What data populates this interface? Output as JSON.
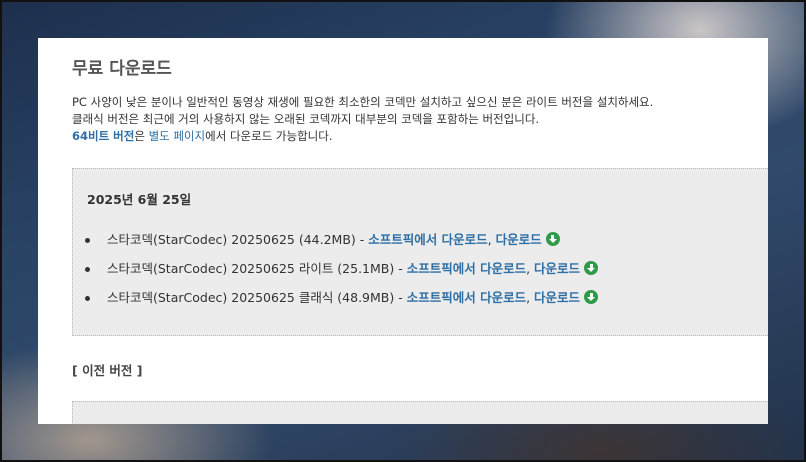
{
  "title": "무료 다운로드",
  "intro": {
    "line1": "PC 사양이 낮은 분이나 일반적인 동영상 재생에 필요한 최소한의 코덱만 설치하고 싶으신 분은 라이트 버전을 설치하세요.",
    "line2": "클래식 버전은 최근에 거의 사용하지 않는 오래된 코덱까지 대부분의 코덱을 포함하는 버전입니다.",
    "line3_link1": "64비트 버전",
    "line3_mid": "은 ",
    "line3_link2": "별도 페이지",
    "line3_end": "에서 다운로드 가능합니다."
  },
  "release": {
    "date": "2025년 6월 25일",
    "items": [
      {
        "name": "스타코덱(StarCodec) 20250625 (44.2MB) - ",
        "link1": "소프트픽에서 다운로드",
        "sep": ", ",
        "link2": "다운로드",
        "icon": "download-icon"
      },
      {
        "name": "스타코덱(StarCodec) 20250625 라이트 (25.1MB) - ",
        "link1": "소프트픽에서 다운로드",
        "sep": ", ",
        "link2": "다운로드",
        "icon": "download-icon"
      },
      {
        "name": "스타코덱(StarCodec) 20250625 클래식 (48.9MB) - ",
        "link1": "소프트픽에서 다운로드",
        "sep": ", ",
        "link2": "다운로드",
        "icon": "download-icon"
      }
    ]
  },
  "previous_heading": "[ 이전 버전 ]",
  "colors": {
    "link": "#2f6fa5",
    "download_icon": "#2e9b4a",
    "box_bg": "#ececec"
  }
}
